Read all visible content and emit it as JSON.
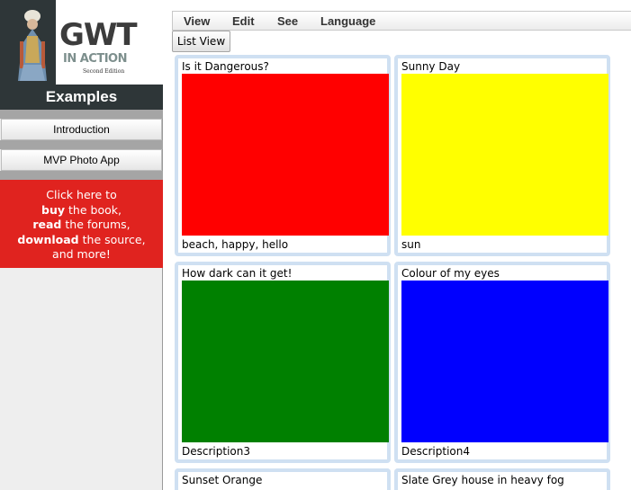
{
  "logo": {
    "title": "GWT",
    "subtitle": "IN ACTION",
    "edition": "Second Edition"
  },
  "sidebar": {
    "header": "Examples",
    "buttons": [
      {
        "label": "Introduction"
      },
      {
        "label": "MVP Photo App"
      }
    ],
    "promo": {
      "line1": "Click here to",
      "buy": "buy",
      "line2": " the book,",
      "read": "read",
      "line3": " the forums,",
      "download": "download",
      "line4": " the source,",
      "line5": "and more!"
    }
  },
  "menubar": {
    "items": [
      "View",
      "Edit",
      "See",
      "Language"
    ]
  },
  "toolbar": {
    "list_view_label": "List View"
  },
  "photos": [
    {
      "title": "Is it Dangerous?",
      "color": "#ff0000",
      "description": "beach, happy, hello"
    },
    {
      "title": "Sunny Day",
      "color": "#ffff00",
      "description": "sun"
    },
    {
      "title": "How dark can it get!",
      "color": "#008000",
      "description": "Description3"
    },
    {
      "title": "Colour of my eyes",
      "color": "#0000ff",
      "description": "Description4"
    },
    {
      "title": "Sunset Orange",
      "color": "#ffa500",
      "description": ""
    },
    {
      "title": "Slate Grey house in heavy fog",
      "color": "#708090",
      "description": ""
    }
  ]
}
